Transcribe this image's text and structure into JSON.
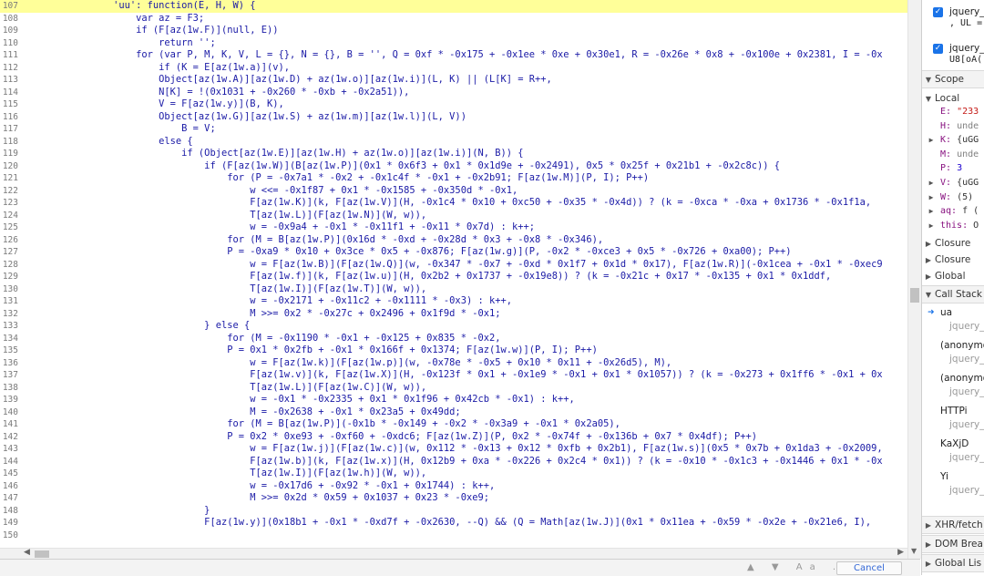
{
  "editor": {
    "highlight_line": 107,
    "lines": [
      {
        "n": "107",
        "t": "                'uu': function(E, H, W) {"
      },
      {
        "n": "108",
        "t": "                    var az = F3;"
      },
      {
        "n": "109",
        "t": "                    if (F[az(1w.F)](null, E))"
      },
      {
        "n": "110",
        "t": "                        return '';"
      },
      {
        "n": "111",
        "t": "                    for (var P, M, K, V, L = {}, N = {}, B = '', Q = 0xf * -0x175 + -0x1ee * 0xe + 0x30e1, R = -0x26e * 0x8 + -0x100e + 0x2381, I = -0x"
      },
      {
        "n": "112",
        "t": "                        if (K = E[az(1w.a)](v),"
      },
      {
        "n": "113",
        "t": "                        Object[az(1w.A)][az(1w.D) + az(1w.o)][az(1w.i)](L, K) || (L[K] = R++,"
      },
      {
        "n": "114",
        "t": "                        N[K] = !(0x1031 + -0x260 * -0xb + -0x2a51)),"
      },
      {
        "n": "115",
        "t": "                        V = F[az(1w.y)](B, K),"
      },
      {
        "n": "116",
        "t": "                        Object[az(1w.G)][az(1w.S) + az(1w.m)][az(1w.l)](L, V))"
      },
      {
        "n": "117",
        "t": "                            B = V;"
      },
      {
        "n": "118",
        "t": "                        else {"
      },
      {
        "n": "119",
        "t": "                            if (Object[az(1w.E)][az(1w.H) + az(1w.o)][az(1w.i)](N, B)) {"
      },
      {
        "n": "120",
        "t": "                                if (F[az(1w.W)](B[az(1w.P)](0x1 * 0x6f3 + 0x1 * 0x1d9e + -0x2491), 0x5 * 0x25f + 0x21b1 + -0x2c8c)) {"
      },
      {
        "n": "121",
        "t": "                                    for (P = -0x7a1 * -0x2 + -0x1c4f * -0x1 + -0x2b91; F[az(1w.M)](P, I); P++)"
      },
      {
        "n": "122",
        "t": "                                        w <<= -0x1f87 + 0x1 * -0x1585 + -0x350d * -0x1,"
      },
      {
        "n": "123",
        "t": "                                        F[az(1w.K)](k, F[az(1w.V)](H, -0x1c4 * 0x10 + 0xc50 + -0x35 * -0x4d)) ? (k = -0xca * -0xa + 0x1736 * -0x1f1a,"
      },
      {
        "n": "124",
        "t": "                                        T[az(1w.L)](F[az(1w.N)](W, w)),"
      },
      {
        "n": "125",
        "t": "                                        w = -0x9a4 + -0x1 * -0x11f1 + -0x11 * 0x7d) : k++;"
      },
      {
        "n": "126",
        "t": "                                    for (M = B[az(1w.P)](0x16d * -0xd + -0x28d * 0x3 + -0x8 * -0x346),"
      },
      {
        "n": "127",
        "t": "                                    P = -0xa9 * 0x10 + 0x3ce * 0x5 + -0x876; F[az(1w.g)](P, -0x2 * -0xce3 + 0x5 * -0x726 + 0xa00); P++)"
      },
      {
        "n": "128",
        "t": "                                        w = F[az(1w.B)](F[az(1w.Q)](w, -0x347 * -0x7 + -0xd * 0x1f7 + 0x1d * 0x17), F[az(1w.R)](-0x1cea + -0x1 * -0xec9"
      },
      {
        "n": "129",
        "t": "                                        F[az(1w.f)](k, F[az(1w.u)](H, 0x2b2 + 0x1737 + -0x19e8)) ? (k = -0x21c + 0x17 * -0x135 + 0x1 * 0x1ddf,"
      },
      {
        "n": "130",
        "t": "                                        T[az(1w.I)](F[az(1w.T)](W, w)),"
      },
      {
        "n": "131",
        "t": "                                        w = -0x2171 + -0x11c2 + -0x1111 * -0x3) : k++,"
      },
      {
        "n": "132",
        "t": "                                        M >>= 0x2 * -0x27c + 0x2496 + 0x1f9d * -0x1;"
      },
      {
        "n": "133",
        "t": "                                } else {"
      },
      {
        "n": "134",
        "t": "                                    for (M = -0x1190 * -0x1 + -0x125 + 0x835 * -0x2,"
      },
      {
        "n": "135",
        "t": "                                    P = 0x1 * 0x2fb + -0x1 * 0x166f + 0x1374; F[az(1w.w)](P, I); P++)"
      },
      {
        "n": "136",
        "t": "                                        w = F[az(1w.k)](F[az(1w.p)](w, -0x78e * -0x5 + 0x10 * 0x11 + -0x26d5), M),"
      },
      {
        "n": "137",
        "t": "                                        F[az(1w.v)](k, F[az(1w.X)](H, -0x123f * 0x1 + -0x1e9 * -0x1 + 0x1 * 0x1057)) ? (k = -0x273 + 0x1ff6 * -0x1 + 0x"
      },
      {
        "n": "138",
        "t": "                                        T[az(1w.L)](F[az(1w.C)](W, w)),"
      },
      {
        "n": "139",
        "t": "                                        w = -0x1 * -0x2335 + 0x1 * 0x1f96 + 0x42cb * -0x1) : k++,"
      },
      {
        "n": "140",
        "t": "                                        M = -0x2638 + -0x1 * 0x23a5 + 0x49dd;"
      },
      {
        "n": "141",
        "t": "                                    for (M = B[az(1w.P)](-0x1b * -0x149 + -0x2 * -0x3a9 + -0x1 * 0x2a05),"
      },
      {
        "n": "142",
        "t": "                                    P = 0x2 * 0xe93 + -0xf60 + -0xdc6; F[az(1w.Z)](P, 0x2 * -0x74f + -0x136b + 0x7 * 0x4df); P++)"
      },
      {
        "n": "143",
        "t": "                                        w = F[az(1w.j)](F[az(1w.c)](w, 0x112 * -0x13 + 0x12 * 0xfb + 0x2b1), F[az(1w.s)](0x5 * 0x7b + 0x1da3 + -0x2009,"
      },
      {
        "n": "144",
        "t": "                                        F[az(1w.b)](k, F[az(1w.x)](H, 0x12b9 + 0xa * -0x226 + 0x2c4 * 0x1)) ? (k = -0x10 * -0x1c3 + -0x1446 + 0x1 * -0x"
      },
      {
        "n": "145",
        "t": "                                        T[az(1w.I)](F[az(1w.h)](W, w)),"
      },
      {
        "n": "146",
        "t": "                                        w = -0x17d6 + -0x92 * -0x1 + 0x1744) : k++,"
      },
      {
        "n": "147",
        "t": "                                        M >>= 0x2d * 0x59 + 0x1037 + 0x23 * -0xe9;"
      },
      {
        "n": "148",
        "t": "                                }"
      },
      {
        "n": "149",
        "t": "                                F[az(1w.y)](0x18b1 + -0x1 * -0xd7f + -0x2630, --Q) && (Q = Math[az(1w.J)](0x1 * 0x11ea + -0x59 * -0x2e + -0x21e6, I),"
      },
      {
        "n": "150",
        "t": ""
      }
    ]
  },
  "searchbar": {
    "icons": "▲ ▼ Aa .*",
    "cancel_label": "Cancel"
  },
  "sidebar": {
    "breakpoints": [
      {
        "file": "jquery_",
        "code": ", UL ="
      },
      {
        "file": "jquery_",
        "code": "U8[oA("
      }
    ],
    "scope_header": "Scope",
    "local_header": "Local",
    "locals": [
      {
        "arrow": "",
        "name": "E:",
        "value": "\"233",
        "kind": "str"
      },
      {
        "arrow": "",
        "name": "H:",
        "value": "unde",
        "kind": "gray"
      },
      {
        "arrow": "▶",
        "name": "K:",
        "value": "{uGG",
        "kind": "plain"
      },
      {
        "arrow": "",
        "name": "M:",
        "value": "unde",
        "kind": "gray"
      },
      {
        "arrow": "",
        "name": "P:",
        "value": "3",
        "kind": "num"
      },
      {
        "arrow": "▶",
        "name": "V:",
        "value": "{uGG",
        "kind": "plain"
      },
      {
        "arrow": "▶",
        "name": "W:",
        "value": "(5)",
        "kind": "plain"
      },
      {
        "arrow": "▶",
        "name": "aq:",
        "value": "f (",
        "kind": "plain"
      },
      {
        "arrow": "▶",
        "name": "this:",
        "value": "O",
        "kind": "plain"
      }
    ],
    "scopes": [
      "Closure",
      "Closure",
      "Global"
    ],
    "callstack_header": "Call Stack",
    "frames": [
      {
        "fn": "ua",
        "loc": "jquery_",
        "current": true
      },
      {
        "fn": "(anonymo",
        "loc": "jquery_",
        "current": false
      },
      {
        "fn": "(anonymo",
        "loc": "jquery_",
        "current": false
      },
      {
        "fn": "HTTPi",
        "loc": "jquery_",
        "current": false
      },
      {
        "fn": "KaXjD",
        "loc": "jquery_",
        "current": false
      },
      {
        "fn": "Yi",
        "loc": "jquery_",
        "current": false
      }
    ],
    "bottom_sections": [
      "XHR/fetch",
      "DOM Brea",
      "Global Lis"
    ]
  }
}
